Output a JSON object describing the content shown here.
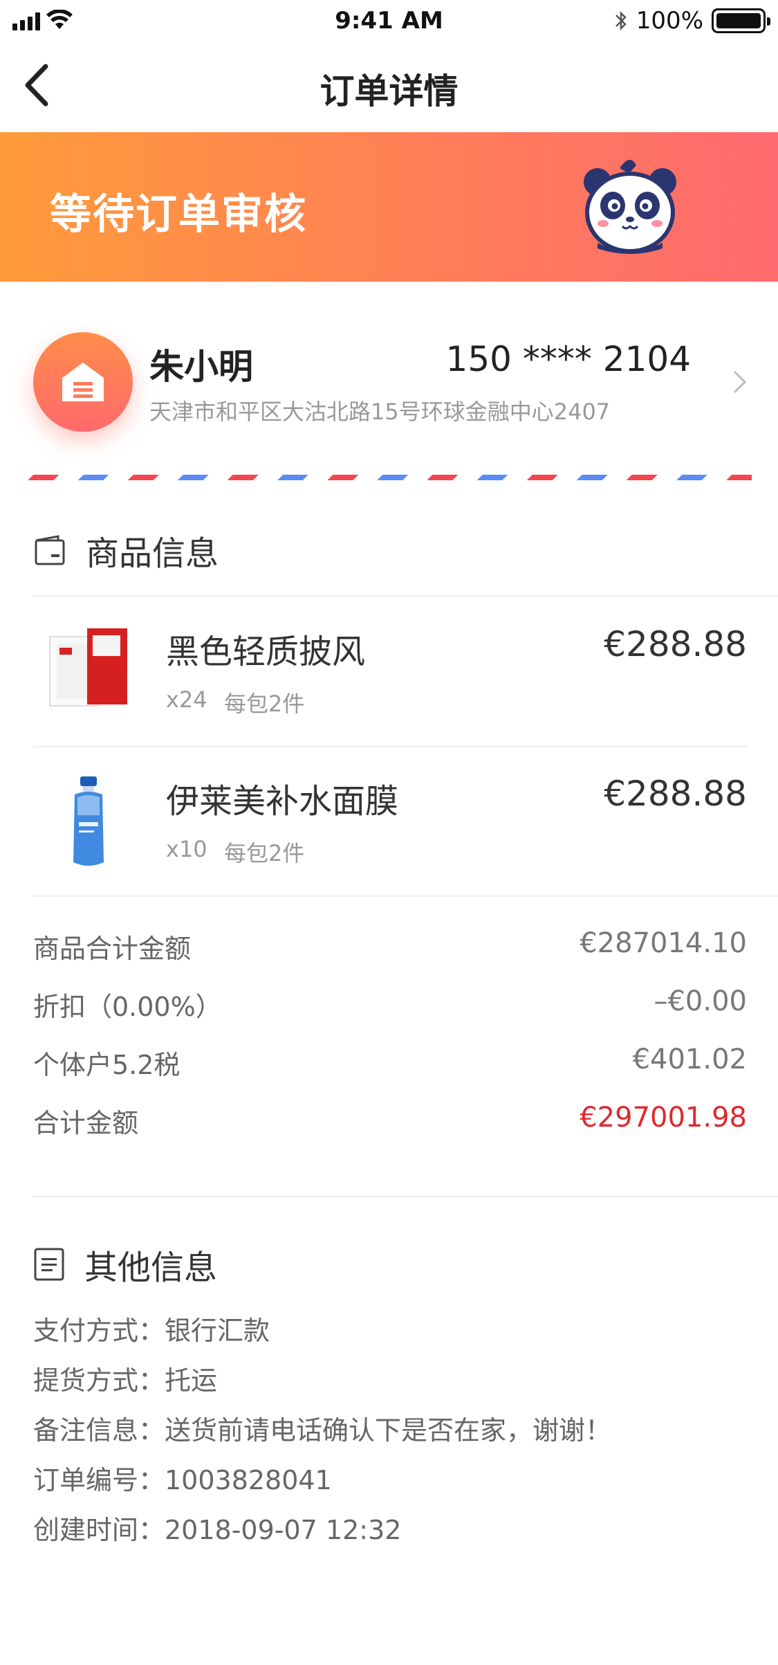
{
  "status_bar": {
    "time": "9:41 AM",
    "battery": "100%",
    "battery_level": 1.0
  },
  "nav": {
    "title": "订单详情",
    "back_icon": "chevron-left-icon"
  },
  "banner": {
    "title": "等待订单审核",
    "mascot_icon": "panda-mascot-icon"
  },
  "address": {
    "name": "朱小明",
    "phone": "150 **** 2104",
    "detail": "天津市和平区大沽北路15号环球金融中心2407",
    "icon": "home-icon"
  },
  "goods_section": {
    "title": "商品信息",
    "icon": "wallet-icon",
    "items": [
      {
        "name": "黑色轻质披风",
        "price": "€288.88",
        "qty": "x24",
        "pack": "每包2件"
      },
      {
        "name": "伊莱美补水面膜",
        "price": "€288.88",
        "qty": "x10",
        "pack": "每包2件"
      }
    ]
  },
  "totals": [
    {
      "label": "商品合计金额",
      "value": "€287014.10"
    },
    {
      "label": "折扣（0.00%）",
      "value": "–€0.00"
    },
    {
      "label": "个体户5.2税",
      "value": "€401.02"
    },
    {
      "label": "合计金额",
      "value": "€297001.98"
    }
  ],
  "other_section": {
    "title": "其他信息",
    "icon": "document-icon",
    "rows": [
      "支付方式：银行汇款",
      "提货方式：托运",
      "备注信息：送货前请电话确认下是否在家，谢谢！",
      "订单编号：1003828041",
      "创建时间：2018-09-07 12:32"
    ]
  },
  "colors": {
    "banner_start": "#ff9b3a",
    "banner_end": "#ff6a6f",
    "total_red": "#e0282e",
    "airmail_red": "#f3474d",
    "airmail_blue": "#5b8cf6"
  }
}
